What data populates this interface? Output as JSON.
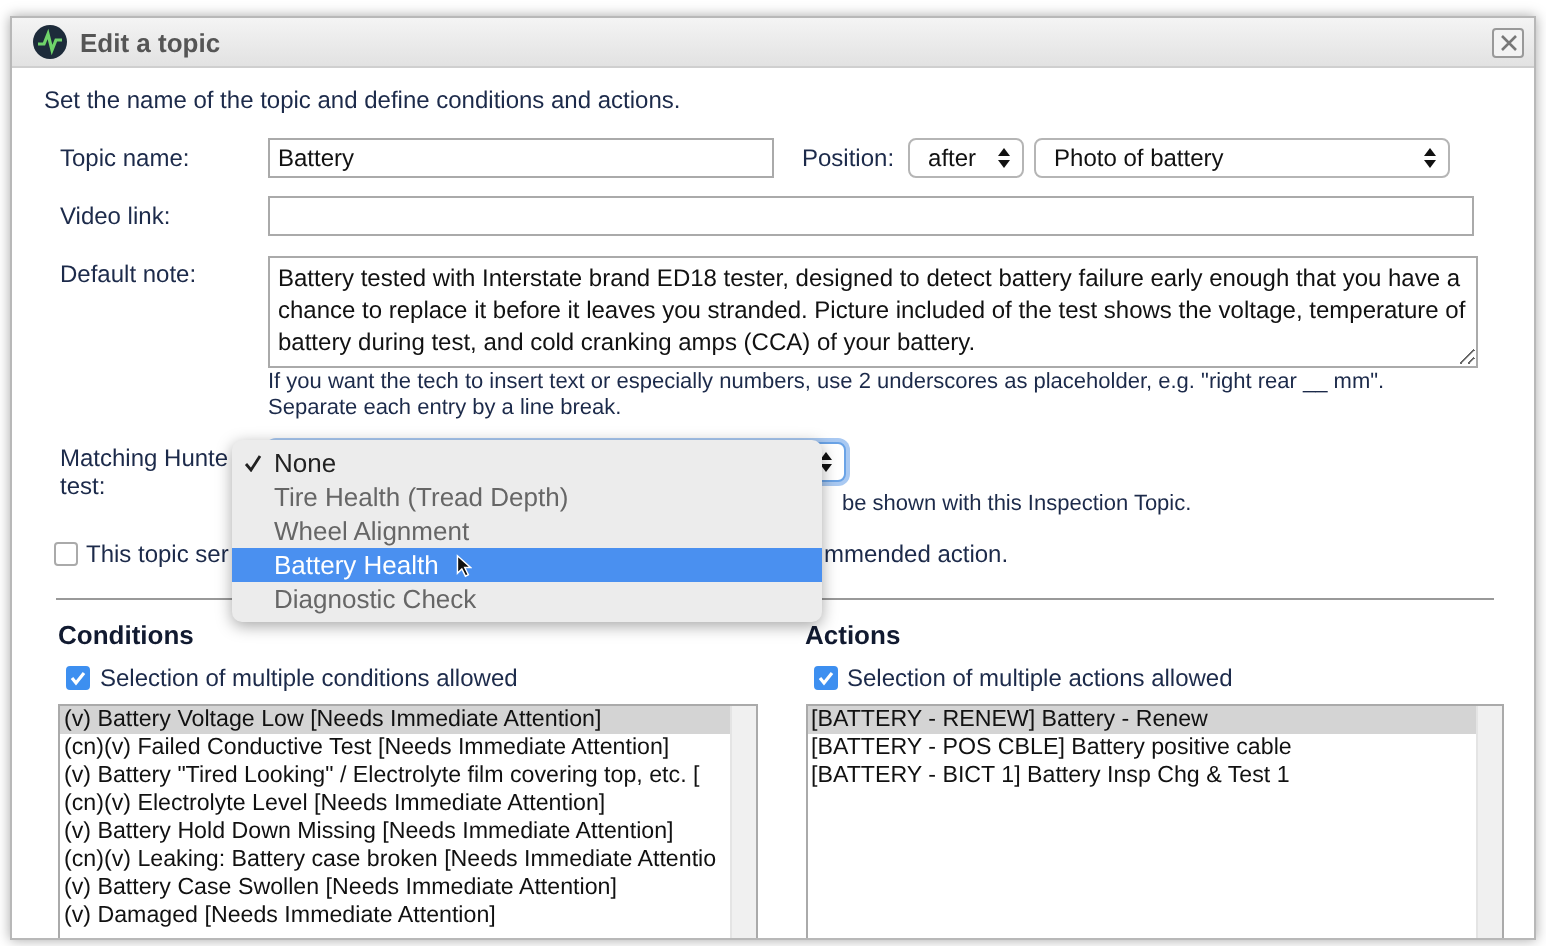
{
  "window": {
    "title": "Edit a topic"
  },
  "intro": "Set the name of the topic and define conditions and actions.",
  "topic_name": {
    "label": "Topic name:",
    "value": "Battery"
  },
  "position": {
    "label": "Position:",
    "relation": "after",
    "topic": "Photo of battery"
  },
  "video_link": {
    "label": "Video link:"
  },
  "default_note": {
    "label": "Default note:",
    "value": "Battery tested with Interstate brand ED18 tester, designed to detect battery failure early enough that you have a chance to replace it before it leaves you stranded. Picture included of the test shows the voltage, temperature of battery during test, and cold cranking amps (CCA) of your battery.",
    "hint_lines": [
      "If you want the tech to insert text or especially numbers, use 2 underscores as placeholder, e.g. \"right rear __ mm\".",
      "Separate each entry by a line break."
    ]
  },
  "matching_test": {
    "label_lines": [
      "Matching Hunte",
      "test:"
    ],
    "note": "be shown with this Inspection Topic.",
    "options": [
      {
        "label": "None",
        "checked": true,
        "selected": false
      },
      {
        "label": "Tire Health (Tread Depth)",
        "checked": false,
        "selected": false
      },
      {
        "label": "Wheel Alignment",
        "checked": false,
        "selected": false
      },
      {
        "label": "Battery Health",
        "checked": false,
        "selected": true
      },
      {
        "label": "Diagnostic Check",
        "checked": false,
        "selected": false
      }
    ]
  },
  "recommend": {
    "checked": false,
    "text_parts": [
      "This topic ser",
      "mmended action."
    ]
  },
  "conditions": {
    "title": "Conditions",
    "multiple": {
      "checked": true,
      "label": "Selection of multiple conditions allowed"
    },
    "items": [
      {
        "text": "(v) Battery Voltage Low [Needs Immediate Attention]",
        "selected": true
      },
      {
        "text": "(cn)(v) Failed Conductive Test [Needs Immediate Attention]",
        "selected": false
      },
      {
        "text": "(v) Battery \"Tired Looking\" / Electrolyte film covering top, etc. [",
        "selected": false
      },
      {
        "text": "(cn)(v) Electrolyte Level [Needs Immediate Attention]",
        "selected": false
      },
      {
        "text": "(v) Battery Hold Down Missing [Needs Immediate Attention]",
        "selected": false
      },
      {
        "text": "(cn)(v) Leaking: Battery case broken [Needs Immediate Attentio",
        "selected": false
      },
      {
        "text": "(v) Battery Case Swollen [Needs Immediate Attention]",
        "selected": false
      },
      {
        "text": "(v) Damaged [Needs Immediate Attention]",
        "selected": false
      }
    ]
  },
  "actions": {
    "title": "Actions",
    "multiple": {
      "checked": true,
      "label": "Selection of multiple actions allowed"
    },
    "items": [
      {
        "text": "[BATTERY - RENEW] Battery - Renew",
        "selected": true
      },
      {
        "text": "[BATTERY - POS CBLE] Battery positive cable",
        "selected": false
      },
      {
        "text": "[BATTERY - BICT 1] Battery Insp Chg & Test 1",
        "selected": false
      }
    ]
  }
}
